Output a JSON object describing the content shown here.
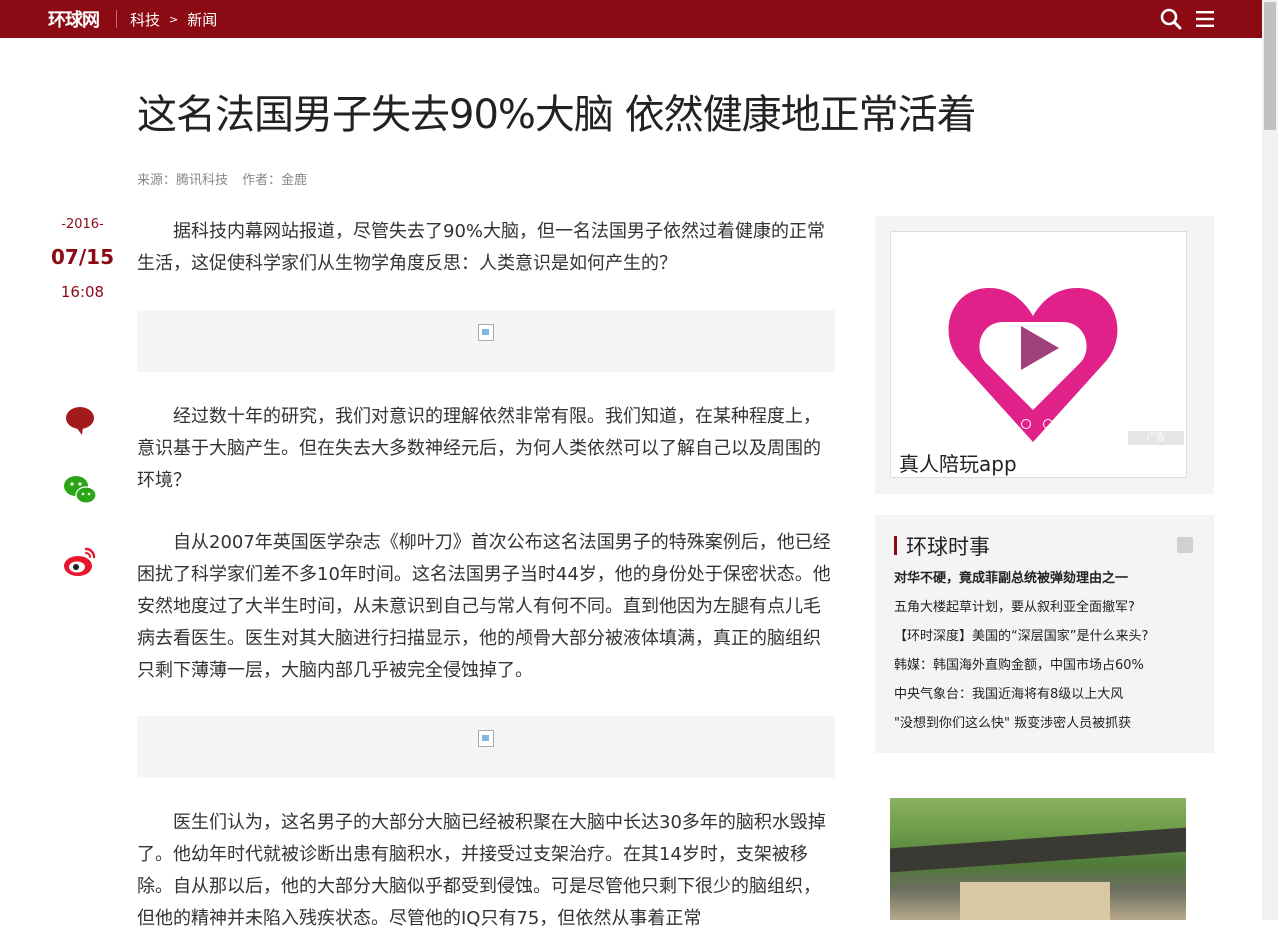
{
  "topbar": {
    "logo": "环球网",
    "crumbs": [
      "科技",
      "新闻"
    ],
    "crumb_sep": ">",
    "bg_color": "#8b0a14"
  },
  "article": {
    "title": "这名法国男子失去90%大脑 依然健康地正常活着",
    "source": "来源：腾讯科技",
    "author": "作者：金鹿",
    "date_year": "-2016-",
    "date_md": "07/15",
    "date_time": "16:08",
    "paragraphs": [
      "据科技内幕网站报道，尽管失去了90%大脑，但一名法国男子依然过着健康的正常生活，这促使科学家们从生物学角度反思：人类意识是如何产生的？",
      "经过数十年的研究，我们对意识的理解依然非常有限。我们知道，在某种程度上，意识基于大脑产生。但在失去大多数神经元后，为何人类依然可以了解自己以及周围的环境？",
      "自从2007年英国医学杂志《柳叶刀》首次公布这名法国男子的特殊案例后，他已经困扰了科学家们差不多10年时间。这名法国男子当时44岁，他的身份处于保密状态。他安然地度过了大半生时间，从未意识到自己与常人有何不同。直到他因为左腿有点儿毛病去看医生。医生对其大脑进行扫描显示，他的颅骨大部分被液体填满，真正的脑组织只剩下薄薄一层，大脑内部几乎被完全侵蚀掉了。",
      "医生们认为，这名男子的大部分大脑已经被积聚在大脑中长达30多年的脑积水毁掉了。他幼年时代就被诊断出患有脑积水，并接受过支架治疗。在其14岁时，支架被移除。自从那以后，他的大部分大脑似乎都受到侵蚀。可是尽管他只剩下很少的脑组织，但他的精神并未陷入残疾状态。尽管他的IQ只有75，但依然从事着正常"
    ]
  },
  "share": {
    "icons": [
      "comment-icon",
      "wechat-icon",
      "weibo-icon"
    ]
  },
  "ad": {
    "caption": "真人陪玩app",
    "tag": "广告",
    "brand_color": "#e0218a"
  },
  "news": {
    "title": "环球时事",
    "items": [
      "对华不硬，竟成菲副总统被弹劾理由之一",
      "五角大楼起草计划，要从叙利亚全面撤军?",
      "【环时深度】美国的“深层国家”是什么来头?",
      "韩媒：韩国海外直购金额，中国市场占60%",
      "中央气象台：我国近海将有8级以上大风",
      "\"没想到你们这么快\" 叛变涉密人员被抓获"
    ]
  }
}
